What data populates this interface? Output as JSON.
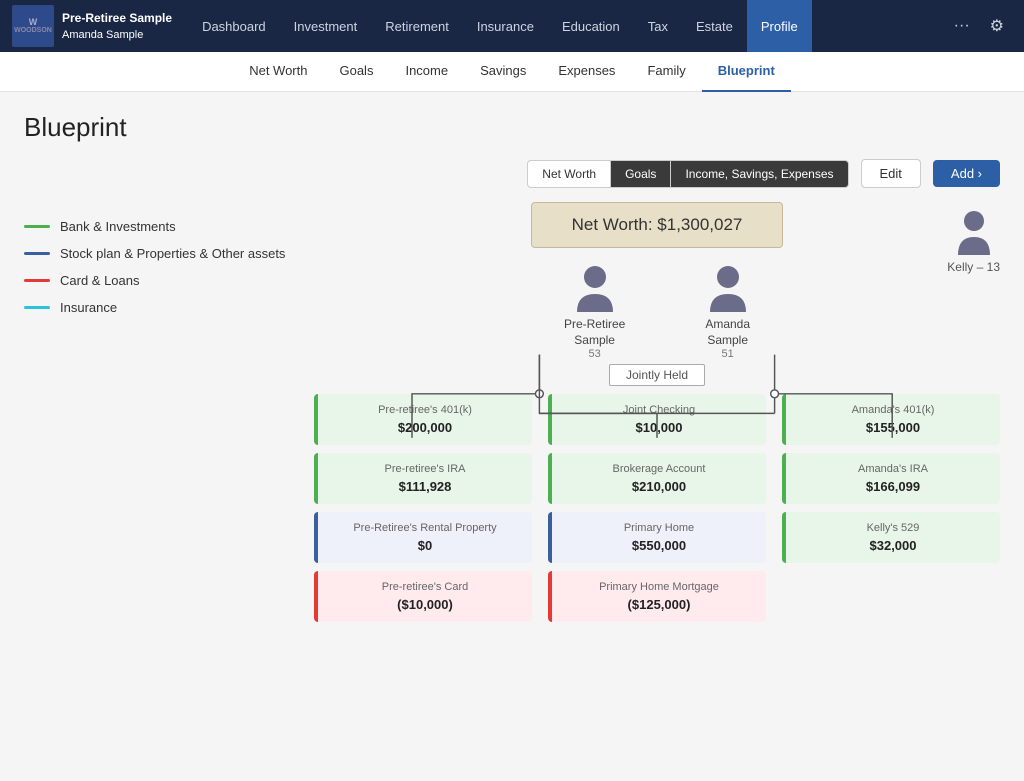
{
  "app": {
    "logo_line1": "Pre-Retiree Sample",
    "logo_line2": "Amanda Sample",
    "logo_abbr": "W"
  },
  "nav": {
    "items": [
      {
        "label": "Dashboard",
        "active": false
      },
      {
        "label": "Investment",
        "active": false
      },
      {
        "label": "Retirement",
        "active": false
      },
      {
        "label": "Insurance",
        "active": false
      },
      {
        "label": "Education",
        "active": false
      },
      {
        "label": "Tax",
        "active": false
      },
      {
        "label": "Estate",
        "active": false
      },
      {
        "label": "Profile",
        "active": true
      }
    ]
  },
  "subnav": {
    "items": [
      {
        "label": "Net Worth",
        "active": false
      },
      {
        "label": "Goals",
        "active": false
      },
      {
        "label": "Income",
        "active": false
      },
      {
        "label": "Savings",
        "active": false
      },
      {
        "label": "Expenses",
        "active": false
      },
      {
        "label": "Family",
        "active": false
      },
      {
        "label": "Blueprint",
        "active": true
      }
    ]
  },
  "page": {
    "title": "Blueprint"
  },
  "tabs": [
    {
      "label": "Net Worth",
      "active": true
    },
    {
      "label": "Goals",
      "active": false
    },
    {
      "label": "Income, Savings, Expenses",
      "active": false
    }
  ],
  "legend": [
    {
      "label": "Bank & Investments",
      "type": "green"
    },
    {
      "label": "Stock plan & Properties & Other assets",
      "type": "blue"
    },
    {
      "label": "Card & Loans",
      "type": "red"
    },
    {
      "label": "Insurance",
      "type": "cyan"
    }
  ],
  "buttons": {
    "edit": "Edit",
    "add": "Add ›"
  },
  "net_worth": {
    "label": "Net Worth: $1,300,027"
  },
  "people": [
    {
      "name": "Pre-Retiree\nSample",
      "name_display": "Pre-Retiree Sample",
      "age": "53"
    },
    {
      "name": "Amanda\nSample",
      "name_display": "Amanda Sample",
      "age": "51"
    }
  ],
  "jointly_held": "Jointly Held",
  "kelly": {
    "name": "Kelly – 13"
  },
  "accounts": {
    "left": [
      {
        "name": "Pre-retiree's 401(k)",
        "value": "$200,000",
        "type": "green"
      },
      {
        "name": "Pre-retiree's IRA",
        "value": "$111,928",
        "type": "green"
      },
      {
        "name": "Pre-Retiree's Rental Property",
        "value": "$0",
        "type": "blue"
      },
      {
        "name": "Pre-retiree's Card",
        "value": "($10,000)",
        "type": "red"
      }
    ],
    "center": [
      {
        "name": "Joint Checking",
        "value": "$10,000",
        "type": "green"
      },
      {
        "name": "Brokerage Account",
        "value": "$210,000",
        "type": "green"
      },
      {
        "name": "Primary Home",
        "value": "$550,000",
        "type": "blue"
      },
      {
        "name": "Primary Home Mortgage",
        "value": "($125,000)",
        "type": "red"
      }
    ],
    "right": [
      {
        "name": "Amanda's 401(k)",
        "value": "$155,000",
        "type": "green"
      },
      {
        "name": "Amanda's IRA",
        "value": "$166,099",
        "type": "green"
      },
      {
        "name": "Kelly's 529",
        "value": "$32,000",
        "type": "green"
      }
    ]
  }
}
